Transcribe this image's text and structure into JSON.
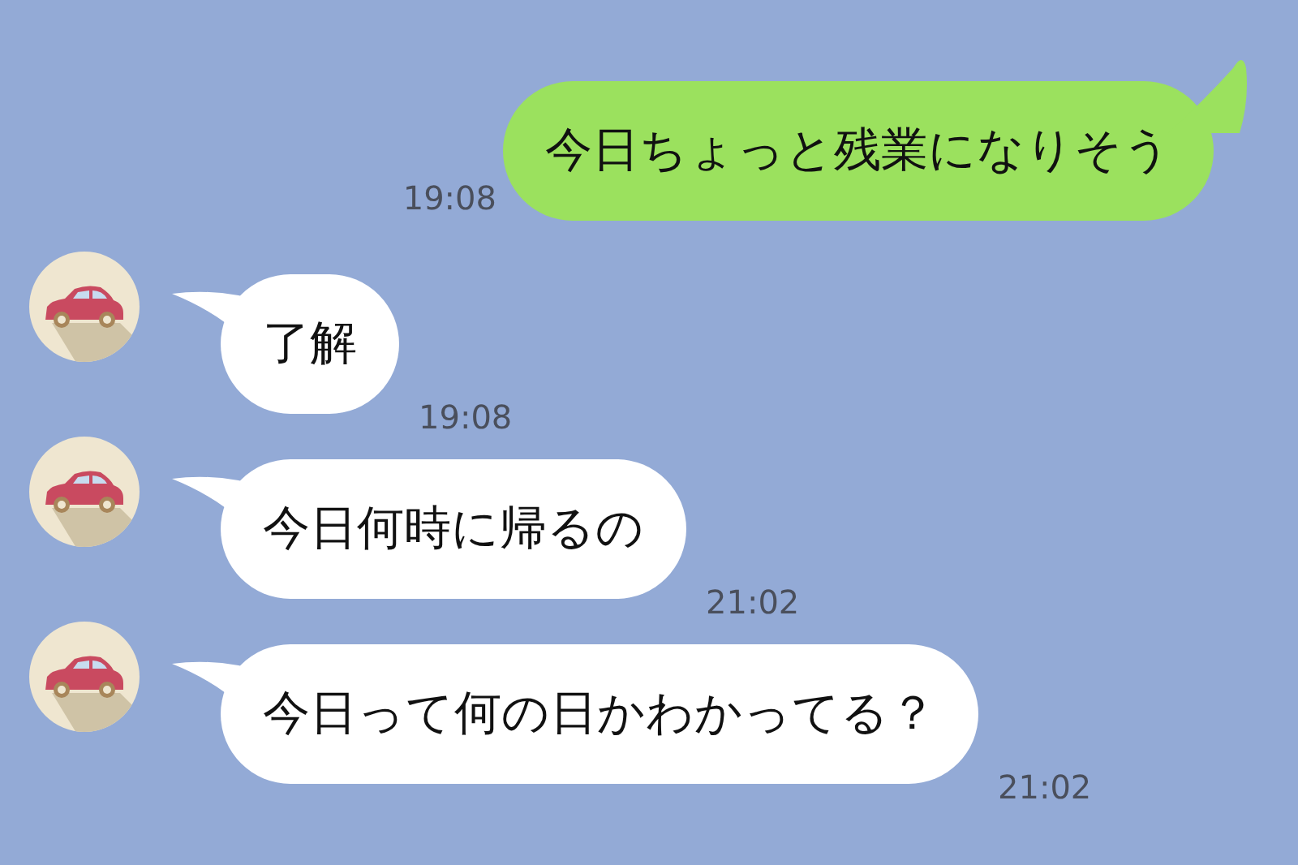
{
  "messages": [
    {
      "kind": "sent",
      "text": "今日ちょっと残業になりそう",
      "time": "19:08"
    },
    {
      "kind": "received",
      "text": "了解",
      "time": "19:08"
    },
    {
      "kind": "received",
      "text": "今日何時に帰るの",
      "time": "21:02"
    },
    {
      "kind": "received",
      "text": "今日って何の日かわかってる？",
      "time": "21:02"
    }
  ]
}
